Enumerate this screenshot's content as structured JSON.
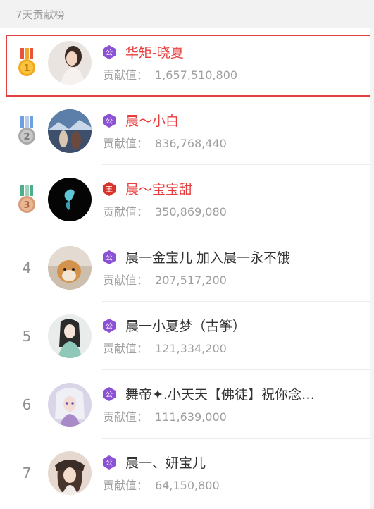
{
  "header": {
    "title": "7天贡献榜"
  },
  "contrib_label": "贡献值：",
  "colors": {
    "highlight_border": "#e2413f",
    "top_name": "#e73d3d",
    "purple_badge": "#8c52d6",
    "red_badge": "#d9342b"
  },
  "entries": [
    {
      "rank": "1",
      "medal": "gold",
      "badge": "公",
      "badge_color": "purple",
      "name": "华矩-晓夏",
      "name_style": "red",
      "contribution": "1,657,510,800",
      "avatar": "woman-portrait"
    },
    {
      "rank": "2",
      "medal": "silver",
      "badge": "公",
      "badge_color": "purple",
      "name": "晨～小白",
      "name_style": "red",
      "contribution": "836,768,440",
      "avatar": "couple-scene"
    },
    {
      "rank": "3",
      "medal": "bronze",
      "badge": "王",
      "badge_color": "red",
      "name": "晨～宝宝甜",
      "name_style": "red",
      "contribution": "350,869,080",
      "avatar": "butterfly"
    },
    {
      "rank": "4",
      "medal": "",
      "badge": "公",
      "badge_color": "purple",
      "name": "晨一金宝儿 加入晨一永不饿",
      "name_style": "dark",
      "contribution": "207,517,200",
      "avatar": "dog"
    },
    {
      "rank": "5",
      "medal": "",
      "badge": "公",
      "badge_color": "purple",
      "name": "晨一小夏梦（古筝）",
      "name_style": "dark",
      "contribution": "121,334,200",
      "avatar": "anime-girl"
    },
    {
      "rank": "6",
      "medal": "",
      "badge": "公",
      "badge_color": "purple",
      "name": "舞帝✦.小天天【佛徒】祝你念…",
      "name_style": "dark",
      "contribution": "111,639,000",
      "avatar": "anime-silver"
    },
    {
      "rank": "7",
      "medal": "",
      "badge": "公",
      "badge_color": "purple",
      "name": "晨一、妍宝儿",
      "name_style": "dark",
      "contribution": "64,150,800",
      "avatar": "woman-hat"
    }
  ]
}
